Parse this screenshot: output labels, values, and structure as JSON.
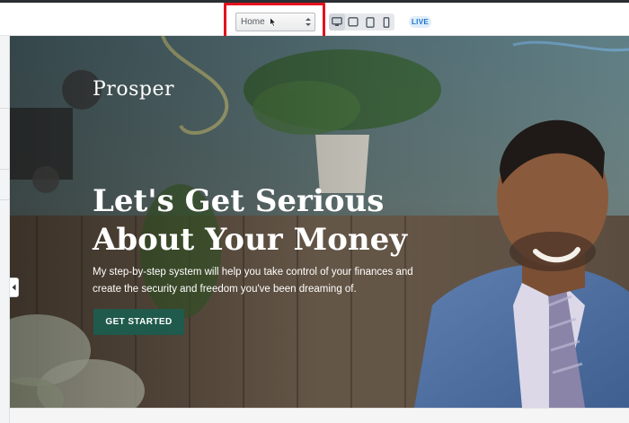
{
  "toolbar": {
    "page_select": {
      "value": "Home"
    },
    "devices": [
      {
        "icon": "desktop-icon",
        "active": true
      },
      {
        "icon": "laptop-icon",
        "active": false
      },
      {
        "icon": "tablet-icon",
        "active": false
      },
      {
        "icon": "mobile-icon",
        "active": false
      }
    ],
    "live_label": "LIVE"
  },
  "hero": {
    "logo": "Prosper",
    "headline_line1": "Let's Get Serious",
    "headline_line2": "About Your Money",
    "subtext_line1": "My step-by-step system will help you take control of your finances and",
    "subtext_line2": "create the security and freedom you've been dreaming of.",
    "cta_label": "GET STARTED"
  },
  "colors": {
    "highlight": "#e3121d",
    "cta_background": "#1f5a4c",
    "live_badge": "#1a72c9"
  }
}
